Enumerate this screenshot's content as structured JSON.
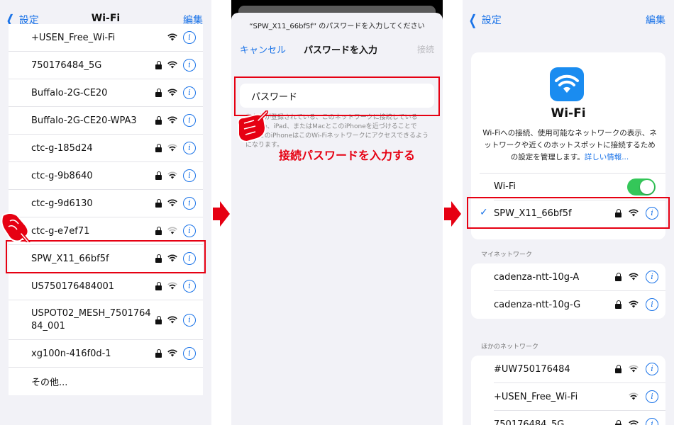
{
  "panel1": {
    "back_label": "設定",
    "title": "Wi-Fi",
    "edit_label": "編集",
    "networks": [
      {
        "name": "+USEN_Free_Wi-Fi",
        "locked": false
      },
      {
        "name": "750176484_5G",
        "locked": true
      },
      {
        "name": "Buffalo-2G-CE20",
        "locked": true
      },
      {
        "name": "Buffalo-2G-CE20-WPA3",
        "locked": true
      },
      {
        "name": "ctc-g-185d24",
        "locked": true
      },
      {
        "name": "ctc-g-9b8640",
        "locked": true
      },
      {
        "name": "ctc-g-9d6130",
        "locked": true
      },
      {
        "name": "ctc-g-e7ef71",
        "locked": true
      },
      {
        "name": "SPW_X11_66bf5f",
        "locked": true
      },
      {
        "name": "US750176484001",
        "locked": true
      },
      {
        "name": "USPOT02_MESH_750176484_001",
        "locked": true
      },
      {
        "name": "xg100n-416f0d-1",
        "locked": true
      }
    ],
    "other_label": "その他..."
  },
  "panel2": {
    "prompt": "“SPW_X11_66bf5f” のパスワードを入力してください",
    "cancel_label": "キャンセル",
    "title": "パスワードを入力",
    "connect_label": "接続",
    "password_placeholder": "パスワード",
    "description": "あなたが登録されている、このネットワークに接続しているiPhone、iPad、またはMacとこのiPhoneを近づけることでも、このiPhoneはこのWi-Fiネットワークにアクセスできるようになります。",
    "instruction": "接続パスワードを入力する"
  },
  "panel3": {
    "back_label": "設定",
    "edit_label": "編集",
    "heading": "Wi-Fi",
    "description": "Wi-Fiへの接続、使用可能なネットワークの表示、ネットワークや近くのホットスポットに接続するための設定を管理します。",
    "more_link": "詳しい情報...",
    "wifi_toggle_label": "Wi-Fi",
    "connected_network": "SPW_X11_66bf5f",
    "my_networks_header": "マイネットワーク",
    "my_networks": [
      "cadenza-ntt-10g-A",
      "cadenza-ntt-10g-G"
    ],
    "other_networks_header": "ほかのネットワーク",
    "other_networks": [
      {
        "name": "#UW750176484",
        "locked": true
      },
      {
        "name": "+USEN_Free_Wi-Fi",
        "locked": false
      },
      {
        "name": "750176484_5G",
        "locked": true
      }
    ]
  },
  "colors": {
    "accent_blue": "#1a73e8",
    "highlight_red": "#e60012",
    "toggle_green": "#34c759"
  }
}
